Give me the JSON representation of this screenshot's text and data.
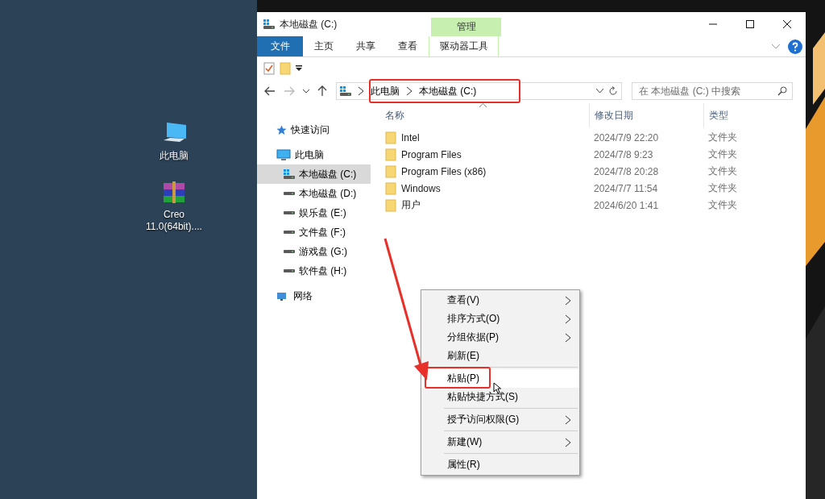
{
  "desktop_icons": [
    {
      "label": "此电脑",
      "kind": "computer"
    },
    {
      "label": "Creo 11.0(64bit)....",
      "kind": "archive"
    }
  ],
  "window": {
    "title": "本地磁盘 (C:)",
    "context_group": "管理",
    "ribbon_tabs": [
      {
        "label": "文件",
        "kind": "file"
      },
      {
        "label": "主页",
        "kind": "normal"
      },
      {
        "label": "共享",
        "kind": "normal"
      },
      {
        "label": "查看",
        "kind": "normal"
      },
      {
        "label": "驱动器工具",
        "kind": "context"
      }
    ],
    "address": {
      "breadcrumbs": [
        "此电脑",
        "本地磁盘 (C:)"
      ]
    },
    "search": {
      "placeholder": "在 本地磁盘 (C:) 中搜索"
    },
    "navigation": [
      {
        "label": "快速访问",
        "kind": "star",
        "selected": false
      },
      {
        "label": "此电脑",
        "kind": "computer",
        "selected": false,
        "children": [
          {
            "label": "本地磁盘 (C:)",
            "kind": "system-drive",
            "selected": true
          },
          {
            "label": "本地磁盘 (D:)",
            "kind": "drive",
            "selected": false
          },
          {
            "label": "娱乐盘 (E:)",
            "kind": "drive",
            "selected": false
          },
          {
            "label": "文件盘 (F:)",
            "kind": "drive",
            "selected": false
          },
          {
            "label": "游戏盘 (G:)",
            "kind": "drive",
            "selected": false
          },
          {
            "label": "软件盘 (H:)",
            "kind": "drive",
            "selected": false
          }
        ]
      },
      {
        "label": "网络",
        "kind": "network",
        "selected": false
      }
    ],
    "columns": [
      "名称",
      "修改日期",
      "类型"
    ],
    "files": [
      {
        "name": "Intel",
        "modified": "2024/7/9 22:20",
        "type": "文件夹"
      },
      {
        "name": "Program Files",
        "modified": "2024/7/8 9:23",
        "type": "文件夹"
      },
      {
        "name": "Program Files (x86)",
        "modified": "2024/7/8 20:28",
        "type": "文件夹"
      },
      {
        "name": "Windows",
        "modified": "2024/7/7 11:54",
        "type": "文件夹"
      },
      {
        "name": "用户",
        "modified": "2024/6/20 1:41",
        "type": "文件夹"
      }
    ]
  },
  "context_menu": [
    {
      "kind": "submenu",
      "label": "查看(V)",
      "selected": false
    },
    {
      "kind": "submenu",
      "label": "排序方式(O)",
      "selected": false
    },
    {
      "kind": "submenu",
      "label": "分组依据(P)",
      "selected": false
    },
    {
      "kind": "item",
      "label": "刷新(E)",
      "selected": false
    },
    {
      "kind": "separator"
    },
    {
      "kind": "item",
      "label": "粘贴(P)",
      "selected": true
    },
    {
      "kind": "item",
      "label": "粘贴快捷方式(S)",
      "selected": false
    },
    {
      "kind": "separator"
    },
    {
      "kind": "submenu",
      "label": "授予访问权限(G)",
      "selected": false
    },
    {
      "kind": "separator"
    },
    {
      "kind": "submenu",
      "label": "新建(W)",
      "selected": false
    },
    {
      "kind": "separator"
    },
    {
      "kind": "item",
      "label": "属性(R)",
      "selected": false
    }
  ]
}
